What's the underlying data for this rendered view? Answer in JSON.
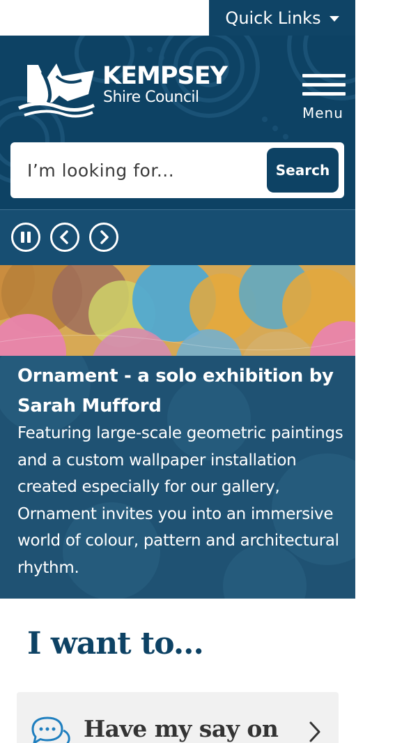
{
  "quick_links": {
    "label": "Quick Links"
  },
  "header": {
    "logo_name": "KEMPSEY",
    "logo_sub": "Shire Council",
    "menu_label": "Menu",
    "search_placeholder": "I’m looking for...",
    "search_button": "Search"
  },
  "slider": {
    "controls": [
      "pause-icon",
      "chevron-left-icon",
      "chevron-right-icon"
    ],
    "title": "Ornament - a solo exhibition by Sarah Mufford",
    "description": "Featuring large-scale geometric paintings and a custom wallpaper installation created especially for our gallery, Ornament invites you into an immersive world of colour, pattern and architectural rhythm."
  },
  "i_want_to": {
    "heading": "I want to...",
    "items": [
      {
        "icon": "speech-bubbles-icon",
        "label": "Have my say on"
      }
    ]
  },
  "colors": {
    "brand_navy": "#0d4264",
    "caption_blue": "#1f5273",
    "card_grey": "#f1f1f1"
  }
}
